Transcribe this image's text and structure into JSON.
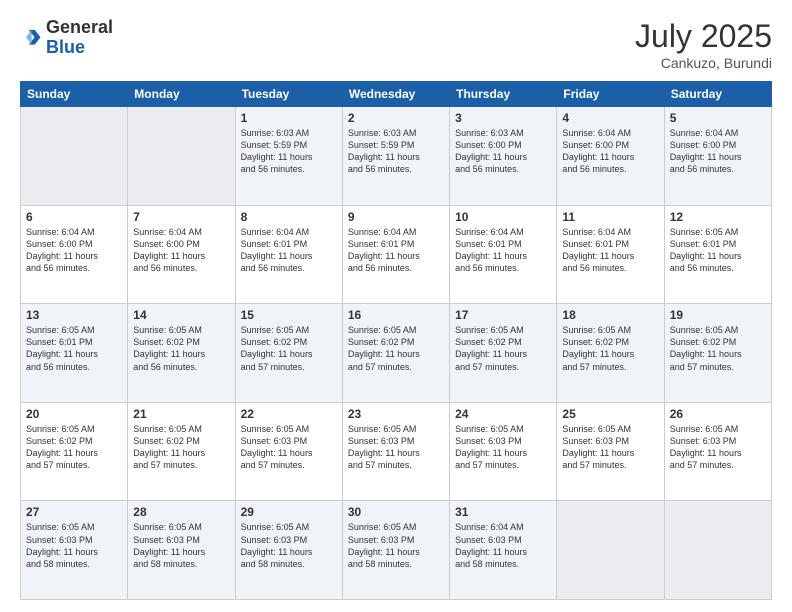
{
  "header": {
    "logo_general": "General",
    "logo_blue": "Blue",
    "title": "July 2025",
    "subtitle": "Cankuzo, Burundi"
  },
  "weekdays": [
    "Sunday",
    "Monday",
    "Tuesday",
    "Wednesday",
    "Thursday",
    "Friday",
    "Saturday"
  ],
  "weeks": [
    {
      "days": [
        {
          "num": "",
          "info": ""
        },
        {
          "num": "",
          "info": ""
        },
        {
          "num": "1",
          "info": "Sunrise: 6:03 AM\nSunset: 5:59 PM\nDaylight: 11 hours\nand 56 minutes."
        },
        {
          "num": "2",
          "info": "Sunrise: 6:03 AM\nSunset: 5:59 PM\nDaylight: 11 hours\nand 56 minutes."
        },
        {
          "num": "3",
          "info": "Sunrise: 6:03 AM\nSunset: 6:00 PM\nDaylight: 11 hours\nand 56 minutes."
        },
        {
          "num": "4",
          "info": "Sunrise: 6:04 AM\nSunset: 6:00 PM\nDaylight: 11 hours\nand 56 minutes."
        },
        {
          "num": "5",
          "info": "Sunrise: 6:04 AM\nSunset: 6:00 PM\nDaylight: 11 hours\nand 56 minutes."
        }
      ]
    },
    {
      "days": [
        {
          "num": "6",
          "info": "Sunrise: 6:04 AM\nSunset: 6:00 PM\nDaylight: 11 hours\nand 56 minutes."
        },
        {
          "num": "7",
          "info": "Sunrise: 6:04 AM\nSunset: 6:00 PM\nDaylight: 11 hours\nand 56 minutes."
        },
        {
          "num": "8",
          "info": "Sunrise: 6:04 AM\nSunset: 6:01 PM\nDaylight: 11 hours\nand 56 minutes."
        },
        {
          "num": "9",
          "info": "Sunrise: 6:04 AM\nSunset: 6:01 PM\nDaylight: 11 hours\nand 56 minutes."
        },
        {
          "num": "10",
          "info": "Sunrise: 6:04 AM\nSunset: 6:01 PM\nDaylight: 11 hours\nand 56 minutes."
        },
        {
          "num": "11",
          "info": "Sunrise: 6:04 AM\nSunset: 6:01 PM\nDaylight: 11 hours\nand 56 minutes."
        },
        {
          "num": "12",
          "info": "Sunrise: 6:05 AM\nSunset: 6:01 PM\nDaylight: 11 hours\nand 56 minutes."
        }
      ]
    },
    {
      "days": [
        {
          "num": "13",
          "info": "Sunrise: 6:05 AM\nSunset: 6:01 PM\nDaylight: 11 hours\nand 56 minutes."
        },
        {
          "num": "14",
          "info": "Sunrise: 6:05 AM\nSunset: 6:02 PM\nDaylight: 11 hours\nand 56 minutes."
        },
        {
          "num": "15",
          "info": "Sunrise: 6:05 AM\nSunset: 6:02 PM\nDaylight: 11 hours\nand 57 minutes."
        },
        {
          "num": "16",
          "info": "Sunrise: 6:05 AM\nSunset: 6:02 PM\nDaylight: 11 hours\nand 57 minutes."
        },
        {
          "num": "17",
          "info": "Sunrise: 6:05 AM\nSunset: 6:02 PM\nDaylight: 11 hours\nand 57 minutes."
        },
        {
          "num": "18",
          "info": "Sunrise: 6:05 AM\nSunset: 6:02 PM\nDaylight: 11 hours\nand 57 minutes."
        },
        {
          "num": "19",
          "info": "Sunrise: 6:05 AM\nSunset: 6:02 PM\nDaylight: 11 hours\nand 57 minutes."
        }
      ]
    },
    {
      "days": [
        {
          "num": "20",
          "info": "Sunrise: 6:05 AM\nSunset: 6:02 PM\nDaylight: 11 hours\nand 57 minutes."
        },
        {
          "num": "21",
          "info": "Sunrise: 6:05 AM\nSunset: 6:02 PM\nDaylight: 11 hours\nand 57 minutes."
        },
        {
          "num": "22",
          "info": "Sunrise: 6:05 AM\nSunset: 6:03 PM\nDaylight: 11 hours\nand 57 minutes."
        },
        {
          "num": "23",
          "info": "Sunrise: 6:05 AM\nSunset: 6:03 PM\nDaylight: 11 hours\nand 57 minutes."
        },
        {
          "num": "24",
          "info": "Sunrise: 6:05 AM\nSunset: 6:03 PM\nDaylight: 11 hours\nand 57 minutes."
        },
        {
          "num": "25",
          "info": "Sunrise: 6:05 AM\nSunset: 6:03 PM\nDaylight: 11 hours\nand 57 minutes."
        },
        {
          "num": "26",
          "info": "Sunrise: 6:05 AM\nSunset: 6:03 PM\nDaylight: 11 hours\nand 57 minutes."
        }
      ]
    },
    {
      "days": [
        {
          "num": "27",
          "info": "Sunrise: 6:05 AM\nSunset: 6:03 PM\nDaylight: 11 hours\nand 58 minutes."
        },
        {
          "num": "28",
          "info": "Sunrise: 6:05 AM\nSunset: 6:03 PM\nDaylight: 11 hours\nand 58 minutes."
        },
        {
          "num": "29",
          "info": "Sunrise: 6:05 AM\nSunset: 6:03 PM\nDaylight: 11 hours\nand 58 minutes."
        },
        {
          "num": "30",
          "info": "Sunrise: 6:05 AM\nSunset: 6:03 PM\nDaylight: 11 hours\nand 58 minutes."
        },
        {
          "num": "31",
          "info": "Sunrise: 6:04 AM\nSunset: 6:03 PM\nDaylight: 11 hours\nand 58 minutes."
        },
        {
          "num": "",
          "info": ""
        },
        {
          "num": "",
          "info": ""
        }
      ]
    }
  ]
}
